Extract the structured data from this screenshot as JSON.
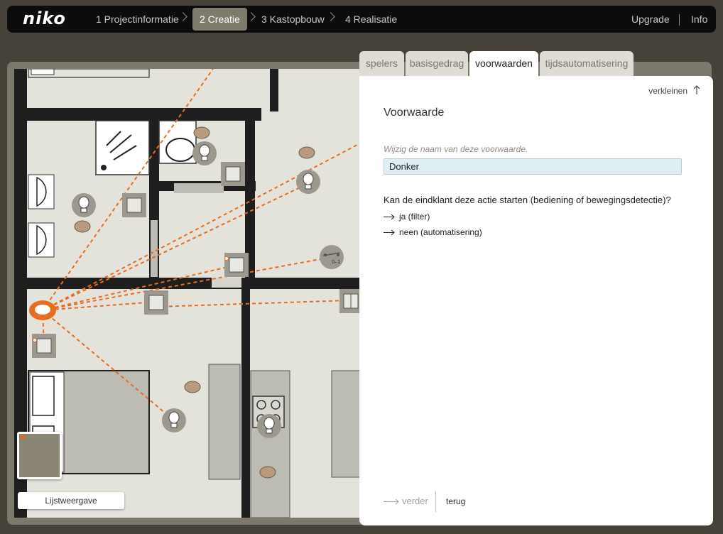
{
  "app": {
    "logo": "niko",
    "steps": [
      {
        "label": "1 Projectinformatie",
        "active": false
      },
      {
        "label": "2 Creatie",
        "active": true
      },
      {
        "label": "3 Kastopbouw",
        "active": false
      },
      {
        "label": "4 Realisatie",
        "active": false
      }
    ],
    "links": {
      "upgrade": "Upgrade",
      "info": "Info"
    }
  },
  "floorplan": {
    "list_view_label": "Lijstweergave",
    "switch_label": "0–1",
    "colors": {
      "wall": "#1e1e1e",
      "room": "#e3e3db",
      "device": "#9c988d",
      "connection": "#e86c1f",
      "bubble": "#b89a7f"
    }
  },
  "panel": {
    "tabs": [
      {
        "label": "spelers",
        "active": false
      },
      {
        "label": "basisgedrag",
        "active": false
      },
      {
        "label": "voorwaarden",
        "active": true
      },
      {
        "label": "tijdsautomatisering",
        "active": false
      }
    ],
    "collapse_label": "verkleinen",
    "title": "Voorwaarde",
    "rename_label": "Wijzig de naam van deze voorwaarde.",
    "name_value": "Donker",
    "question": "Kan de eindklant deze actie starten (bediening of bewegingsdetectie)?",
    "options": [
      "ja (filter)",
      "neen (automatisering)"
    ],
    "next_label": "verder",
    "back_label": "terug"
  }
}
